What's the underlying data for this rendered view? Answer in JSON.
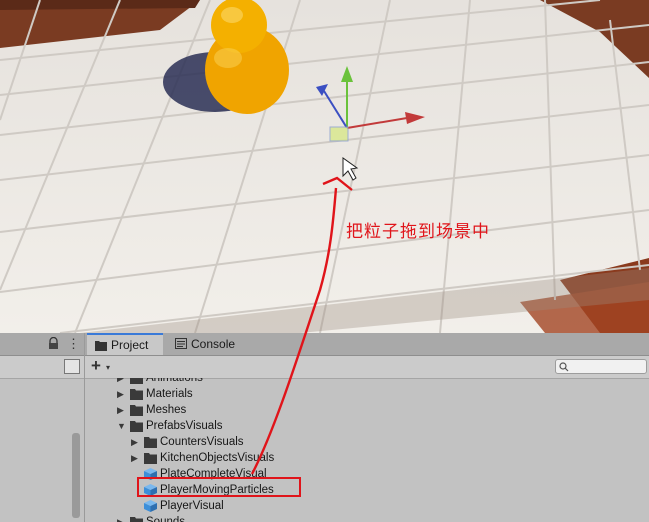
{
  "annotation": {
    "text": "把粒子拖到场景中"
  },
  "tabs": [
    {
      "label": "Project",
      "icon": "folder-icon",
      "active": true
    },
    {
      "label": "Console",
      "icon": "console-icon",
      "active": false
    }
  ],
  "toolbar": {
    "add_label": "+",
    "add_caret": "▾",
    "search_placeholder": ""
  },
  "tree": [
    {
      "label": "Animations",
      "type": "folder",
      "depth": 0,
      "expanded": false
    },
    {
      "label": "Materials",
      "type": "folder",
      "depth": 0,
      "expanded": false
    },
    {
      "label": "Meshes",
      "type": "folder",
      "depth": 0,
      "expanded": false
    },
    {
      "label": "PrefabsVisuals",
      "type": "folder",
      "depth": 0,
      "expanded": true
    },
    {
      "label": "CountersVisuals",
      "type": "folder",
      "depth": 1,
      "expanded": false
    },
    {
      "label": "KitchenObjectsVisuals",
      "type": "folder",
      "depth": 1,
      "expanded": false
    },
    {
      "label": "PlateCompleteVisual",
      "type": "prefab",
      "depth": 1
    },
    {
      "label": "PlayerMovingParticles",
      "type": "prefab",
      "depth": 1,
      "highlighted": true
    },
    {
      "label": "PlayerVisual",
      "type": "prefab",
      "depth": 1
    },
    {
      "label": "Sounds",
      "type": "folder",
      "depth": 0,
      "expanded": false
    }
  ],
  "colors": {
    "annotation_red": "#e0141a",
    "prefab_blue": "#3d8fd9",
    "tab_accent": "#3a7ad8"
  }
}
